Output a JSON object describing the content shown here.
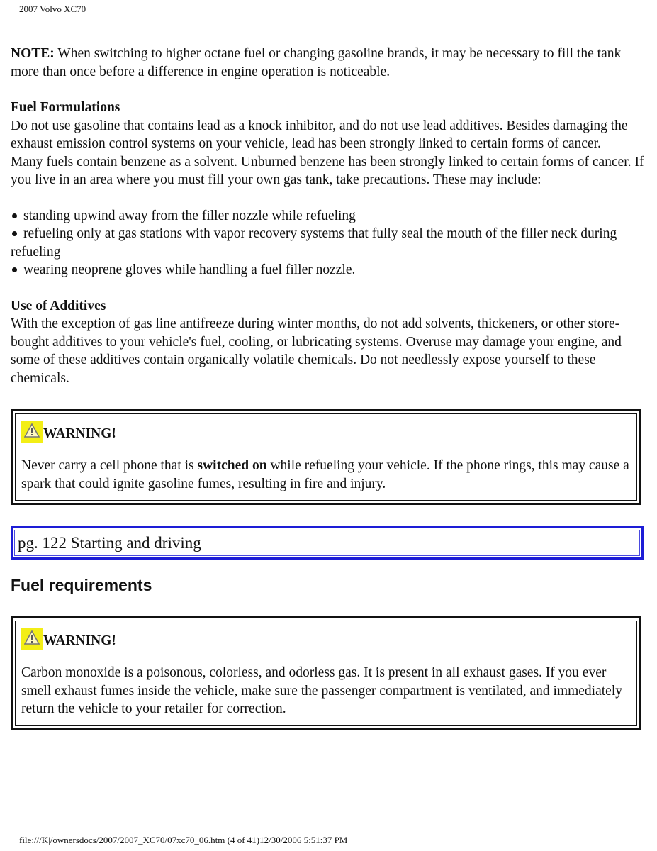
{
  "header": {
    "title": "2007 Volvo XC70"
  },
  "note": {
    "label": "NOTE:",
    "text": " When switching to higher octane fuel or changing gasoline brands, it may be necessary to fill the tank more than once before a difference in engine operation is noticeable."
  },
  "fuel_formulations": {
    "heading": "Fuel Formulations",
    "paragraph1": "Do not use gasoline that contains lead as a knock inhibitor, and do not use lead additives. Besides damaging the exhaust emission control systems on your vehicle, lead has been strongly linked to certain forms of cancer.",
    "paragraph2": "Many fuels contain benzene as a solvent. Unburned benzene has been strongly linked to certain forms of cancer. If you live in an area where you must fill your own gas tank, take precautions. These may include:",
    "bullets": [
      "standing upwind away from the filler nozzle while refueling",
      "refueling only at gas stations with vapor recovery systems that fully seal the mouth of the filler neck during refueling",
      "wearing neoprene gloves while handling a fuel filler nozzle."
    ]
  },
  "additives": {
    "heading": "Use of Additives",
    "paragraph": "With the exception of gas line antifreeze during winter months, do not add solvents, thickeners, or other store-bought additives to your vehicle's fuel, cooling, or lubricating systems. Overuse may damage your engine, and some of these additives contain organically volatile chemicals. Do not needlessly expose yourself to these chemicals."
  },
  "warning1": {
    "icon": "warning-triangle-icon",
    "title": "WARNING!",
    "text_before": "Never carry a cell phone that is ",
    "text_bold": "switched on",
    "text_after": " while refueling your vehicle. If the phone rings, this may cause a spark that could ignite gasoline fumes, resulting in fire and injury."
  },
  "page_marker": {
    "text": "pg. 122 Starting and driving",
    "color": "#1d1dd6"
  },
  "fuel_requirements": {
    "heading": "Fuel requirements"
  },
  "warning2": {
    "icon": "warning-triangle-icon",
    "title": "WARNING!",
    "text": "Carbon monoxide is a poisonous, colorless, and odorless gas. It is present in all exhaust gases. If you ever smell exhaust fumes inside the vehicle, make sure the passenger compartment is ventilated, and immediately return the vehicle to your retailer for correction."
  },
  "colors": {
    "warning_icon_bg": "#f3ee16",
    "border": "#111111",
    "page_box": "#1d1dd6"
  },
  "footer": {
    "url": "file:///K|/ownersdocs/2007/2007_XC70/07xc70_06.htm (4 of 41)12/30/2006 5:51:37 PM"
  }
}
